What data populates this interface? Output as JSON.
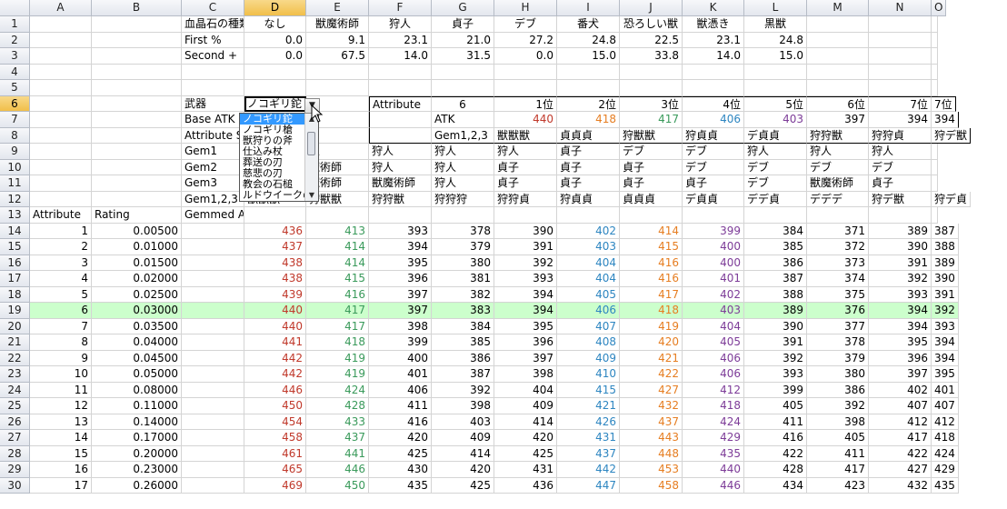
{
  "sheet": {
    "columns": [
      "A",
      "B",
      "C",
      "D",
      "E",
      "F",
      "G",
      "H",
      "I",
      "J",
      "K",
      "L",
      "M",
      "N",
      "O"
    ],
    "selected_column": "D",
    "selected_row": 6,
    "highlight_row": 19,
    "rows": [
      {
        "n": 1,
        "cells": {
          "C": "血晶石の種類",
          "D": "なし",
          "E": "獣魔術師",
          "F": "狩人",
          "G": "貞子",
          "H": "デブ",
          "I": "番犬",
          "J": "恐ろしい獣",
          "K": "獣憑き",
          "L": "黒獣"
        }
      },
      {
        "n": 2,
        "cells": {
          "C": "First %",
          "D": "0.0",
          "E": "9.1",
          "F": "23.1",
          "G": "21.0",
          "H": "27.2",
          "I": "24.8",
          "J": "22.5",
          "K": "23.1",
          "L": "24.8"
        }
      },
      {
        "n": 3,
        "cells": {
          "C": "Second +",
          "D": "0.0",
          "E": "67.5",
          "F": "14.0",
          "G": "31.5",
          "H": "0.0",
          "I": "15.0",
          "J": "33.8",
          "K": "14.0",
          "L": "15.0"
        }
      },
      {
        "n": 4,
        "cells": {}
      },
      {
        "n": 5,
        "cells": {}
      },
      {
        "n": 6,
        "cells": {
          "C": "武器",
          "D": "ノコギリ鉈",
          "F": "Attribute",
          "G": "6",
          "H": "1位",
          "I": "2位",
          "J": "3位",
          "K": "4位",
          "L": "5位",
          "M": "6位",
          "N": "7位",
          "O": "7位"
        }
      },
      {
        "n": 7,
        "cells": {
          "C": "Base ATK",
          "G": "ATK",
          "H": "440",
          "I": "418",
          "J": "417",
          "K": "406",
          "L": "403",
          "M": "397",
          "N": "394",
          "O": "394"
        }
      },
      {
        "n": 8,
        "cells": {
          "C": "Attribute Scaling",
          "G": "Gem1,2,3",
          "H": "獣獣獣",
          "I": "貞貞貞",
          "J": "狩獣獣",
          "K": "狩貞貞",
          "L": "デ貞貞",
          "M": "狩狩獣",
          "N": "狩狩貞",
          "O": "狩デ獣"
        }
      },
      {
        "n": 9,
        "cells": {
          "C": "Gem1",
          "D": "",
          "E": "人",
          "F": "狩人",
          "G": "狩人",
          "H": "狩人",
          "I": "貞子",
          "J": "デブ",
          "K": "デブ",
          "L": "狩人",
          "M": "狩人",
          "N": "狩人",
          "O": ""
        }
      },
      {
        "n": 10,
        "cells": {
          "C": "Gem2",
          "E": "魔術師",
          "F": "狩人",
          "G": "狩人",
          "H": "貞子",
          "I": "貞子",
          "J": "貞子",
          "K": "デブ",
          "L": "デブ",
          "M": "デブ",
          "N": "デブ",
          "O": ""
        }
      },
      {
        "n": 11,
        "cells": {
          "C": "Gem3",
          "E": "魔術師",
          "F": "獣魔術師",
          "G": "狩人",
          "H": "貞子",
          "I": "貞子",
          "J": "貞子",
          "K": "貞子",
          "L": "デブ",
          "M": "獣魔術師",
          "N": "貞子",
          "O": ""
        }
      },
      {
        "n": 12,
        "cells": {
          "C": "Gem1,2,3",
          "D": "獣獣獣",
          "E": "狩獣獣",
          "F": "狩狩獣",
          "G": "狩狩狩",
          "H": "狩狩貞",
          "I": "狩貞貞",
          "J": "貞貞貞",
          "K": "デ貞貞",
          "L": "デデ貞",
          "M": "デデデ",
          "N": "狩デ獣",
          "O": "狩デ貞"
        }
      },
      {
        "n": 13,
        "cells": {
          "A": "Attribute",
          "B": "Rating",
          "C": "Gemmed ATK"
        }
      }
    ],
    "table": [
      [
        "1",
        "0.00500",
        "436",
        "413",
        "393",
        "378",
        "390",
        "402",
        "414",
        "399",
        "384",
        "371",
        "389",
        "387"
      ],
      [
        "2",
        "0.01000",
        "437",
        "414",
        "394",
        "379",
        "391",
        "403",
        "415",
        "400",
        "385",
        "372",
        "390",
        "388"
      ],
      [
        "3",
        "0.01500",
        "438",
        "414",
        "395",
        "380",
        "392",
        "404",
        "416",
        "400",
        "386",
        "373",
        "391",
        "389"
      ],
      [
        "4",
        "0.02000",
        "438",
        "415",
        "396",
        "381",
        "393",
        "404",
        "416",
        "401",
        "387",
        "374",
        "392",
        "390"
      ],
      [
        "5",
        "0.02500",
        "439",
        "416",
        "397",
        "382",
        "394",
        "405",
        "417",
        "402",
        "388",
        "375",
        "393",
        "391"
      ],
      [
        "6",
        "0.03000",
        "440",
        "417",
        "397",
        "383",
        "394",
        "406",
        "418",
        "403",
        "389",
        "376",
        "394",
        "392"
      ],
      [
        "7",
        "0.03500",
        "440",
        "417",
        "398",
        "384",
        "395",
        "407",
        "419",
        "404",
        "390",
        "377",
        "394",
        "393"
      ],
      [
        "8",
        "0.04000",
        "441",
        "418",
        "399",
        "385",
        "396",
        "408",
        "420",
        "405",
        "391",
        "378",
        "395",
        "394"
      ],
      [
        "9",
        "0.04500",
        "442",
        "419",
        "400",
        "386",
        "397",
        "409",
        "421",
        "406",
        "392",
        "379",
        "396",
        "394"
      ],
      [
        "10",
        "0.05000",
        "442",
        "419",
        "401",
        "387",
        "398",
        "410",
        "422",
        "406",
        "393",
        "380",
        "397",
        "395"
      ],
      [
        "11",
        "0.08000",
        "446",
        "424",
        "406",
        "392",
        "404",
        "415",
        "427",
        "412",
        "399",
        "386",
        "402",
        "401"
      ],
      [
        "12",
        "0.11000",
        "450",
        "428",
        "411",
        "398",
        "409",
        "421",
        "432",
        "418",
        "405",
        "392",
        "407",
        "407"
      ],
      [
        "13",
        "0.14000",
        "454",
        "433",
        "416",
        "403",
        "414",
        "426",
        "437",
        "424",
        "411",
        "398",
        "412",
        "412"
      ],
      [
        "14",
        "0.17000",
        "458",
        "437",
        "420",
        "409",
        "420",
        "431",
        "443",
        "429",
        "416",
        "405",
        "417",
        "418"
      ],
      [
        "15",
        "0.20000",
        "461",
        "441",
        "425",
        "414",
        "425",
        "437",
        "448",
        "435",
        "422",
        "411",
        "422",
        "424"
      ],
      [
        "16",
        "0.23000",
        "465",
        "446",
        "430",
        "420",
        "431",
        "442",
        "453",
        "440",
        "428",
        "417",
        "427",
        "429"
      ],
      [
        "17",
        "0.26000",
        "469",
        "450",
        "435",
        "425",
        "436",
        "447",
        "458",
        "446",
        "434",
        "423",
        "432",
        "435"
      ]
    ]
  },
  "dropdown": {
    "options": [
      "ノコギリ鉈",
      "ノコギリ槍",
      "獣狩りの斧",
      "仕込み杖",
      "葬送の刃",
      "慈悲の刃",
      "教会の石槌",
      "ルドウイークの"
    ],
    "selected_index": 0
  },
  "colors": {
    "D": "#c0392b",
    "E": "#3a9a5b",
    "I": "#2e86c1",
    "J": "#e67e22",
    "K": "#7d3c98",
    "H7": "#c0392b",
    "I7": "#e67e22",
    "J7": "#3a9a5b",
    "K7": "#2e86c1",
    "L7": "#7d3c98"
  }
}
